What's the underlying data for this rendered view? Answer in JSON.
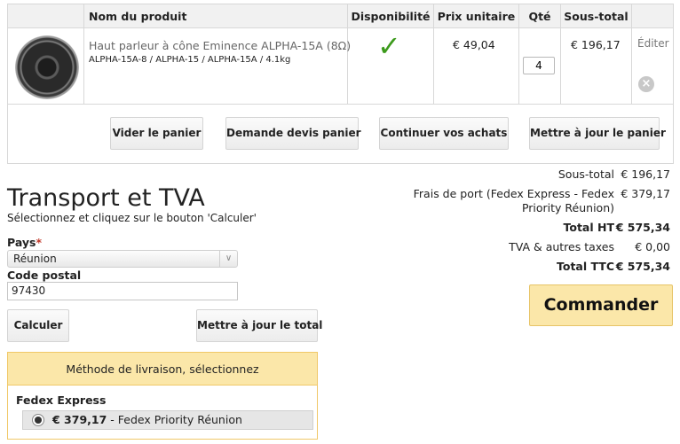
{
  "cart": {
    "headers": {
      "product": "Nom du produit",
      "availability": "Disponibilité",
      "unit_price": "Prix unitaire",
      "qty": "Qté",
      "subtotal": "Sous-total"
    },
    "item": {
      "name": "Haut parleur à cône Eminence ALPHA-15A (8Ω)",
      "details": "ALPHA-15A-8 / ALPHA-15 / ALPHA-15A / 4.1kg",
      "availability_icon": "check-icon",
      "unit_price": "€ 49,04",
      "qty": "4",
      "subtotal": "€ 196,17",
      "edit_label": "Éditer",
      "delete_icon": "close-icon"
    },
    "buttons": {
      "empty": "Vider le panier",
      "quote": "Demande devis panier",
      "continue": "Continuer vos achats",
      "update": "Mettre à jour le panier"
    }
  },
  "transport": {
    "title": "Transport et TVA",
    "hint": "Sélectionnez et cliquez sur le bouton 'Calculer'",
    "country_label": "Pays",
    "required_mark": "*",
    "country_value": "Réunion",
    "postal_label": "Code postal",
    "postal_value": "97430",
    "calc_button": "Calculer",
    "update_total_button": "Mettre à jour le total",
    "shipping_header": "Méthode de livraison, sélectionnez",
    "carrier": "Fedex Express",
    "option_price": "€ 379,17",
    "option_label": " - Fedex Priority Réunion"
  },
  "totals": {
    "subtotal_label": "Sous-total",
    "subtotal_value": "€ 196,17",
    "shipping_label_1": "Frais de port (Fedex Express - Fedex",
    "shipping_label_2": "Priority Réunion)",
    "shipping_value": "€ 379,17",
    "total_ht_label": "Total HT",
    "total_ht_value": "€ 575,34",
    "tax_label": "TVA & autres taxes",
    "tax_value": "€ 0,00",
    "total_ttc_label": "Total TTC",
    "total_ttc_value": "€ 575,34",
    "order_button": "Commander"
  },
  "colors": {
    "accent_yellow": "#fbe7a9",
    "accent_border": "#f0c868",
    "check_green": "#3c9a1c"
  }
}
